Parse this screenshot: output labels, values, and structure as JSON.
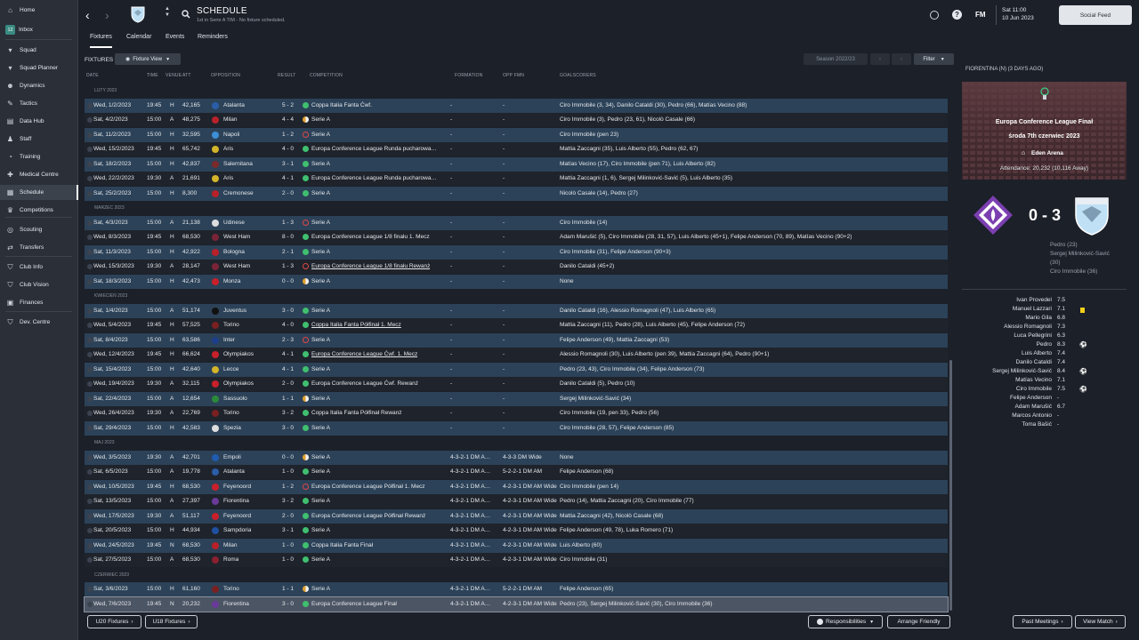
{
  "sidebar": {
    "items": [
      {
        "label": "Home",
        "icon": "home-icon"
      },
      {
        "label": "Inbox",
        "icon": "inbox-icon",
        "badge": "12"
      },
      {
        "label": "Squad",
        "icon": "shirt-icon"
      },
      {
        "label": "Squad Planner",
        "icon": "shirt-icon"
      },
      {
        "label": "Dynamics",
        "icon": "dynamics-icon"
      },
      {
        "label": "Tactics",
        "icon": "tactics-icon"
      },
      {
        "label": "Data Hub",
        "icon": "data-hub-icon"
      },
      {
        "label": "Staff",
        "icon": "staff-icon"
      },
      {
        "label": "Training",
        "icon": "training-icon"
      },
      {
        "label": "Medical Centre",
        "icon": "medical-icon"
      },
      {
        "label": "Schedule",
        "icon": "schedule-icon",
        "active": true
      },
      {
        "label": "Competitions",
        "icon": "trophy-icon"
      },
      {
        "label": "Scouting",
        "icon": "scouting-icon"
      },
      {
        "label": "Transfers",
        "icon": "transfers-icon"
      },
      {
        "label": "Club Info",
        "icon": "club-info-icon"
      },
      {
        "label": "Club Vision",
        "icon": "club-vision-icon"
      },
      {
        "label": "Finances",
        "icon": "finances-icon"
      },
      {
        "label": "Dev. Centre",
        "icon": "dev-centre-icon"
      }
    ]
  },
  "header": {
    "title": "SCHEDULE",
    "subtitle": "1st in Serie A TIM - No fixture scheduled.",
    "date_line1": "Sat 11:00",
    "date_line2": "10 Jun 2023",
    "social_feed": "Social Feed",
    "fm": "FM"
  },
  "tabs": [
    "Fixtures",
    "Calendar",
    "Events",
    "Reminders"
  ],
  "toolbar": {
    "fixtures_label": "FIXTURES",
    "fixture_view": "Fixture View",
    "season": "Season 2022/23",
    "filter": "Filter"
  },
  "columns": [
    "DATE",
    "TIME",
    "VENUE",
    "ATT",
    "OPPOSITION",
    "RESULT",
    "COMPETITION",
    "FORMATION",
    "OPP FMN",
    "GOALSCORERS"
  ],
  "rows": [
    {
      "type": "month",
      "label": "LUTY 2023"
    },
    {
      "date": "Wed, 1/2/2023",
      "time": "19:45",
      "venue": "H",
      "att": "42,165",
      "opp": "Atalanta",
      "res": "5 - 2",
      "comp": "Coppa Italia Fanta Ćwf.",
      "ci": "cup",
      "form": "-",
      "ofm": "-",
      "gs": "Ciro Immobile (3, 34), Danilo Cataldi (30), Pedro (66), Matías Vecino (88)",
      "bc": "#2a5ea8"
    },
    {
      "date": "Sat, 4/2/2023",
      "time": "15:00",
      "venue": "A",
      "att": "48,275",
      "opp": "Milan",
      "res": "4 - 4",
      "comp": "Serie A",
      "ci": "draw",
      "form": "-",
      "ofm": "-",
      "gs": "Ciro Immobile (3), Pedro (23, 61), Nicolò Casale (66)",
      "bc": "#b8212a"
    },
    {
      "date": "Sat, 11/2/2023",
      "time": "15:00",
      "venue": "H",
      "att": "32,595",
      "opp": "Napoli",
      "res": "1 - 2",
      "comp": "Serie A",
      "ci": "loss",
      "form": "-",
      "ofm": "-",
      "gs": "Ciro Immobile (pen 23)",
      "bc": "#3c8fd6"
    },
    {
      "date": "Wed, 15/2/2023",
      "time": "19:45",
      "venue": "H",
      "att": "65,742",
      "opp": "Aris",
      "res": "4 - 0",
      "comp": "Europa Conference League Runda pucharowa…",
      "ci": "win",
      "form": "-",
      "ofm": "-",
      "gs": "Mattia Zaccagni (35), Luis Alberto (55), Pedro (62, 67)",
      "bc": "#d4b42a"
    },
    {
      "date": "Sat, 18/2/2023",
      "time": "15:00",
      "venue": "H",
      "att": "42,837",
      "opp": "Salernitana",
      "res": "3 - 1",
      "comp": "Serie A",
      "ci": "win",
      "form": "-",
      "ofm": "-",
      "gs": "Matías Vecino (17), Ciro Immobile (pen 71), Luis Alberto (82)",
      "bc": "#7a2a2a"
    },
    {
      "date": "Wed, 22/2/2023",
      "time": "19:30",
      "venue": "A",
      "att": "21,691",
      "opp": "Aris",
      "res": "4 - 1",
      "comp": "Europa Conference League Runda pucharowa…",
      "ci": "win",
      "form": "-",
      "ofm": "-",
      "gs": "Mattia Zaccagni (1, 6), Sergej Milinković-Savić (5), Luis Alberto (35)",
      "bc": "#d4b42a"
    },
    {
      "date": "Sat, 25/2/2023",
      "time": "15:00",
      "venue": "H",
      "att": "8,300",
      "opp": "Cremonese",
      "res": "2 - 0",
      "comp": "Serie A",
      "ci": "win",
      "form": "-",
      "ofm": "-",
      "gs": "Nicolò Casale (14), Pedro (27)",
      "bc": "#b8212a"
    },
    {
      "type": "month",
      "label": "MARZEC 2023"
    },
    {
      "date": "Sat, 4/3/2023",
      "time": "15:00",
      "venue": "A",
      "att": "21,138",
      "opp": "Udinese",
      "res": "1 - 3",
      "comp": "Serie A",
      "ci": "loss",
      "form": "-",
      "ofm": "-",
      "gs": "Ciro Immobile (14)",
      "bc": "#dddddd"
    },
    {
      "date": "Wed, 8/3/2023",
      "time": "19:45",
      "venue": "H",
      "att": "68,530",
      "opp": "West Ham",
      "res": "8 - 0",
      "comp": "Europa Conference League 1/8 finału 1. Mecz",
      "ci": "win",
      "form": "-",
      "ofm": "-",
      "gs": "Adam Marušić (5), Ciro Immobile (28, 31, 57), Luis Alberto (45+1), Felipe Anderson (70, 89), Matías Vecino (90+2)",
      "bc": "#7a2438"
    },
    {
      "date": "Sat, 11/3/2023",
      "time": "15:00",
      "venue": "H",
      "att": "42,922",
      "opp": "Bologna",
      "res": "2 - 1",
      "comp": "Serie A",
      "ci": "win",
      "form": "-",
      "ofm": "-",
      "gs": "Ciro Immobile (31), Felipe Anderson (90+3)",
      "bc": "#b8212a"
    },
    {
      "date": "Wed, 15/3/2023",
      "time": "19:30",
      "venue": "A",
      "att": "28,147",
      "opp": "West Ham",
      "res": "1 - 3",
      "comp": "Europa Conference League 1/8 finału Rewanż",
      "ci": "loss",
      "ul": true,
      "form": "-",
      "ofm": "-",
      "gs": "Danilo Cataldi (45+2)",
      "bc": "#7a2438"
    },
    {
      "date": "Sat, 18/3/2023",
      "time": "15:00",
      "venue": "H",
      "att": "42,473",
      "opp": "Monza",
      "res": "0 - 0",
      "comp": "Serie A",
      "ci": "draw",
      "form": "-",
      "ofm": "-",
      "gs": "None",
      "bc": "#c8202a"
    },
    {
      "type": "month",
      "label": "KWIECIEŃ 2023"
    },
    {
      "date": "Sat, 1/4/2023",
      "time": "15:00",
      "venue": "A",
      "att": "51,174",
      "opp": "Juventus",
      "res": "3 - 0",
      "comp": "Serie A",
      "ci": "win",
      "form": "-",
      "ofm": "-",
      "gs": "Danilo Cataldi (16), Alessio Romagnoli (47), Luis Alberto (65)",
      "bc": "#111111"
    },
    {
      "date": "Wed, 5/4/2023",
      "time": "19:45",
      "venue": "H",
      "att": "57,525",
      "opp": "Torino",
      "res": "4 - 0",
      "comp": "Coppa Italia Fanta Półfinał 1. Mecz",
      "ci": "win",
      "ul": true,
      "form": "-",
      "ofm": "-",
      "gs": "Mattia Zaccagni (11), Pedro (28), Luis Alberto (45), Felipe Anderson (72)",
      "bc": "#7a2020"
    },
    {
      "date": "Sat, 8/4/2023",
      "time": "15:00",
      "venue": "H",
      "att": "63,586",
      "opp": "Inter",
      "res": "2 - 3",
      "comp": "Serie A",
      "ci": "loss",
      "form": "-",
      "ofm": "-",
      "gs": "Felipe Anderson (49), Mattia Zaccagni (53)",
      "bc": "#1d3f8a"
    },
    {
      "date": "Wed, 12/4/2023",
      "time": "19:45",
      "venue": "H",
      "att": "66,624",
      "opp": "Olympiakos",
      "res": "4 - 1",
      "comp": "Europa Conference League Ćwf. 1. Mecz",
      "ci": "win",
      "ul": true,
      "form": "-",
      "ofm": "-",
      "gs": "Alessio Romagnoli (30), Luis Alberto (pen 39), Mattia Zaccagni (64), Pedro (90+1)",
      "bc": "#c8202a"
    },
    {
      "date": "Sat, 15/4/2023",
      "time": "15:00",
      "venue": "H",
      "att": "42,640",
      "opp": "Lecce",
      "res": "4 - 1",
      "comp": "Serie A",
      "ci": "win",
      "form": "-",
      "ofm": "-",
      "gs": "Pedro (23, 43), Ciro Immobile (34), Felipe Anderson (73)",
      "bc": "#d4b42a"
    },
    {
      "date": "Wed, 19/4/2023",
      "time": "19:30",
      "venue": "A",
      "att": "32,115",
      "opp": "Olympiakos",
      "res": "2 - 0",
      "comp": "Europa Conference League Ćwf. Rewanż",
      "ci": "win",
      "form": "-",
      "ofm": "-",
      "gs": "Danilo Cataldi (5), Pedro (10)",
      "bc": "#c8202a"
    },
    {
      "date": "Sat, 22/4/2023",
      "time": "15:00",
      "venue": "A",
      "att": "12,654",
      "opp": "Sassuolo",
      "res": "1 - 1",
      "comp": "Serie A",
      "ci": "draw",
      "form": "-",
      "ofm": "-",
      "gs": "Sergej Milinković-Savić (34)",
      "bc": "#2a8a3a"
    },
    {
      "date": "Wed, 26/4/2023",
      "time": "19:30",
      "venue": "A",
      "att": "22,769",
      "opp": "Torino",
      "res": "3 - 2",
      "comp": "Coppa Italia Fanta Półfinał Rewanż",
      "ci": "cup",
      "form": "-",
      "ofm": "-",
      "gs": "Ciro Immobile (19, pen 33), Pedro (56)",
      "bc": "#7a2020"
    },
    {
      "date": "Sat, 29/4/2023",
      "time": "15:00",
      "venue": "H",
      "att": "42,583",
      "opp": "Spezia",
      "res": "3 - 0",
      "comp": "Serie A",
      "ci": "win",
      "form": "-",
      "ofm": "-",
      "gs": "Ciro Immobile (28, 57), Felipe Anderson (85)",
      "bc": "#dddddd"
    },
    {
      "type": "month",
      "label": "MAJ 2023"
    },
    {
      "date": "Wed, 3/5/2023",
      "time": "19:30",
      "venue": "A",
      "att": "42,701",
      "opp": "Empoli",
      "res": "0 - 0",
      "comp": "Serie A",
      "ci": "draw",
      "form": "4-3-2-1 DM A…",
      "ofm": "4-3-3 DM Wide",
      "gs": "None",
      "bc": "#1f5bb0"
    },
    {
      "date": "Sat, 6/5/2023",
      "time": "15:00",
      "venue": "A",
      "att": "19,778",
      "opp": "Atalanta",
      "res": "1 - 0",
      "comp": "Serie A",
      "ci": "win",
      "form": "4-3-2-1 DM A…",
      "ofm": "5-2-2-1 DM AM",
      "gs": "Felipe Anderson (68)",
      "bc": "#2a5ea8"
    },
    {
      "date": "Wed, 10/5/2023",
      "time": "19:45",
      "venue": "H",
      "att": "68,530",
      "opp": "Feyenoord",
      "res": "1 - 2",
      "comp": "Europa Conference League Półfinał 1. Mecz",
      "ci": "loss",
      "form": "4-3-2-1 DM A…",
      "ofm": "4-2-3-1 DM AM Wide",
      "gs": "Ciro Immobile (pen 14)",
      "bc": "#c8202a"
    },
    {
      "date": "Sat, 13/5/2023",
      "time": "15:00",
      "venue": "A",
      "att": "27,397",
      "opp": "Fiorentina",
      "res": "3 - 2",
      "comp": "Serie A",
      "ci": "win",
      "form": "4-3-2-1 DM A…",
      "ofm": "4-2-3-1 DM AM Wide",
      "gs": "Pedro (14), Mattia Zaccagni (20), Ciro Immobile (77)",
      "bc": "#6a3a9a"
    },
    {
      "date": "Wed, 17/5/2023",
      "time": "19:30",
      "venue": "A",
      "att": "51,117",
      "opp": "Feyenoord",
      "res": "2 - 0",
      "comp": "Europa Conference League Półfinał Rewanż",
      "ci": "win",
      "form": "4-3-2-1 DM A…",
      "ofm": "4-2-3-1 DM AM Wide",
      "gs": "Mattia Zaccagni (42), Nicolò Casale (68)",
      "bc": "#c8202a"
    },
    {
      "date": "Sat, 20/5/2023",
      "time": "15:00",
      "venue": "H",
      "att": "44,934",
      "opp": "Sampdoria",
      "res": "3 - 1",
      "comp": "Serie A",
      "ci": "win",
      "form": "4-3-2-1 DM A…",
      "ofm": "4-2-3-1 DM AM Wide",
      "gs": "Felipe Anderson (49, 78), Luka Romero (71)",
      "bc": "#1f4fa0"
    },
    {
      "date": "Wed, 24/5/2023",
      "time": "19:45",
      "venue": "N",
      "att": "68,530",
      "opp": "Milan",
      "res": "1 - 0",
      "comp": "Coppa Italia Fanta Finał",
      "ci": "win",
      "form": "4-3-2-1 DM A…",
      "ofm": "4-2-3-1 DM AM Wide",
      "gs": "Luis Alberto (60)",
      "bc": "#b8212a"
    },
    {
      "date": "Sat, 27/5/2023",
      "time": "15:00",
      "venue": "A",
      "att": "68,530",
      "opp": "Roma",
      "res": "1 - 0",
      "comp": "Serie A",
      "ci": "win",
      "form": "4-3-2-1 DM A…",
      "ofm": "4-2-3-1 DM AM Wide",
      "gs": "Ciro Immobile (31)",
      "bc": "#8a2030"
    },
    {
      "type": "month",
      "label": "CZERWIEC 2023"
    },
    {
      "date": "Sat, 3/6/2023",
      "time": "15:00",
      "venue": "H",
      "att": "61,160",
      "opp": "Torino",
      "res": "1 - 1",
      "comp": "Serie A",
      "ci": "draw",
      "form": "4-3-2-1 DM A…",
      "ofm": "5-2-2-1 DM AM",
      "gs": "Felipe Anderson (65)",
      "bc": "#7a2020"
    },
    {
      "date": "Wed, 7/6/2023",
      "time": "19:45",
      "venue": "N",
      "att": "20,232",
      "opp": "Fiorentina",
      "res": "3 - 0",
      "comp": "Europa Conference League Finał",
      "ci": "win",
      "form": "4-3-2-1 DM A…",
      "ofm": "4-2-3-1 DM AM Wide",
      "gs": "Pedro (23), Sergej Milinković-Savić (30), Ciro Immobile (36)",
      "bc": "#6a3a9a",
      "sel": true
    }
  ],
  "right_panel": {
    "header": "FIORENTINA (N) (3 DAYS AGO)",
    "comp": "Europa Conference League Finał",
    "date": "środa 7th czerwiec 2023",
    "stadium": "Eden Arena",
    "attendance": "Attendance: 20,232 (10,116 Away)",
    "score": "0 - 3",
    "scorers": [
      "Pedro (23)",
      "Sergej Milinković-Savić",
      "(30)",
      "Ciro Immobile (36)"
    ],
    "lineup": [
      {
        "name": "Ivan Provedel",
        "rating": "7.5",
        "mark": ""
      },
      {
        "name": "Manuel Lazzari",
        "rating": "7.1",
        "mark": "yellow"
      },
      {
        "name": "Mario Gila",
        "rating": "6.8",
        "mark": ""
      },
      {
        "name": "Alessio Romagnoli",
        "rating": "7.3",
        "mark": ""
      },
      {
        "name": "Luca Pellegrini",
        "rating": "6.3",
        "mark": ""
      },
      {
        "name": "Pedro",
        "rating": "8.3",
        "mark": "ball"
      },
      {
        "name": "Luis Alberto",
        "rating": "7.4",
        "mark": ""
      },
      {
        "name": "Danilo Cataldi",
        "rating": "7.4",
        "mark": ""
      },
      {
        "name": "Sergej Milinković-Savić",
        "rating": "8.4",
        "mark": "ball"
      },
      {
        "name": "Matías Vecino",
        "rating": "7.1",
        "mark": ""
      },
      {
        "name": "Ciro Immobile",
        "rating": "7.5",
        "mark": "ball"
      },
      {
        "name": "Felipe Anderson",
        "rating": "-",
        "mark": ""
      },
      {
        "name": "Adam Marušić",
        "rating": "6.7",
        "mark": ""
      },
      {
        "name": "Marcos Antonio",
        "rating": "-",
        "mark": ""
      },
      {
        "name": "Toma Bašić",
        "rating": "-",
        "mark": ""
      }
    ]
  },
  "bottom": {
    "u20": "U20 Fixtures",
    "u18": "U18 Fixtures",
    "responsibilities": "Responsibilities",
    "arrange": "Arrange Friendly",
    "past": "Past Meetings",
    "view": "View Match"
  }
}
